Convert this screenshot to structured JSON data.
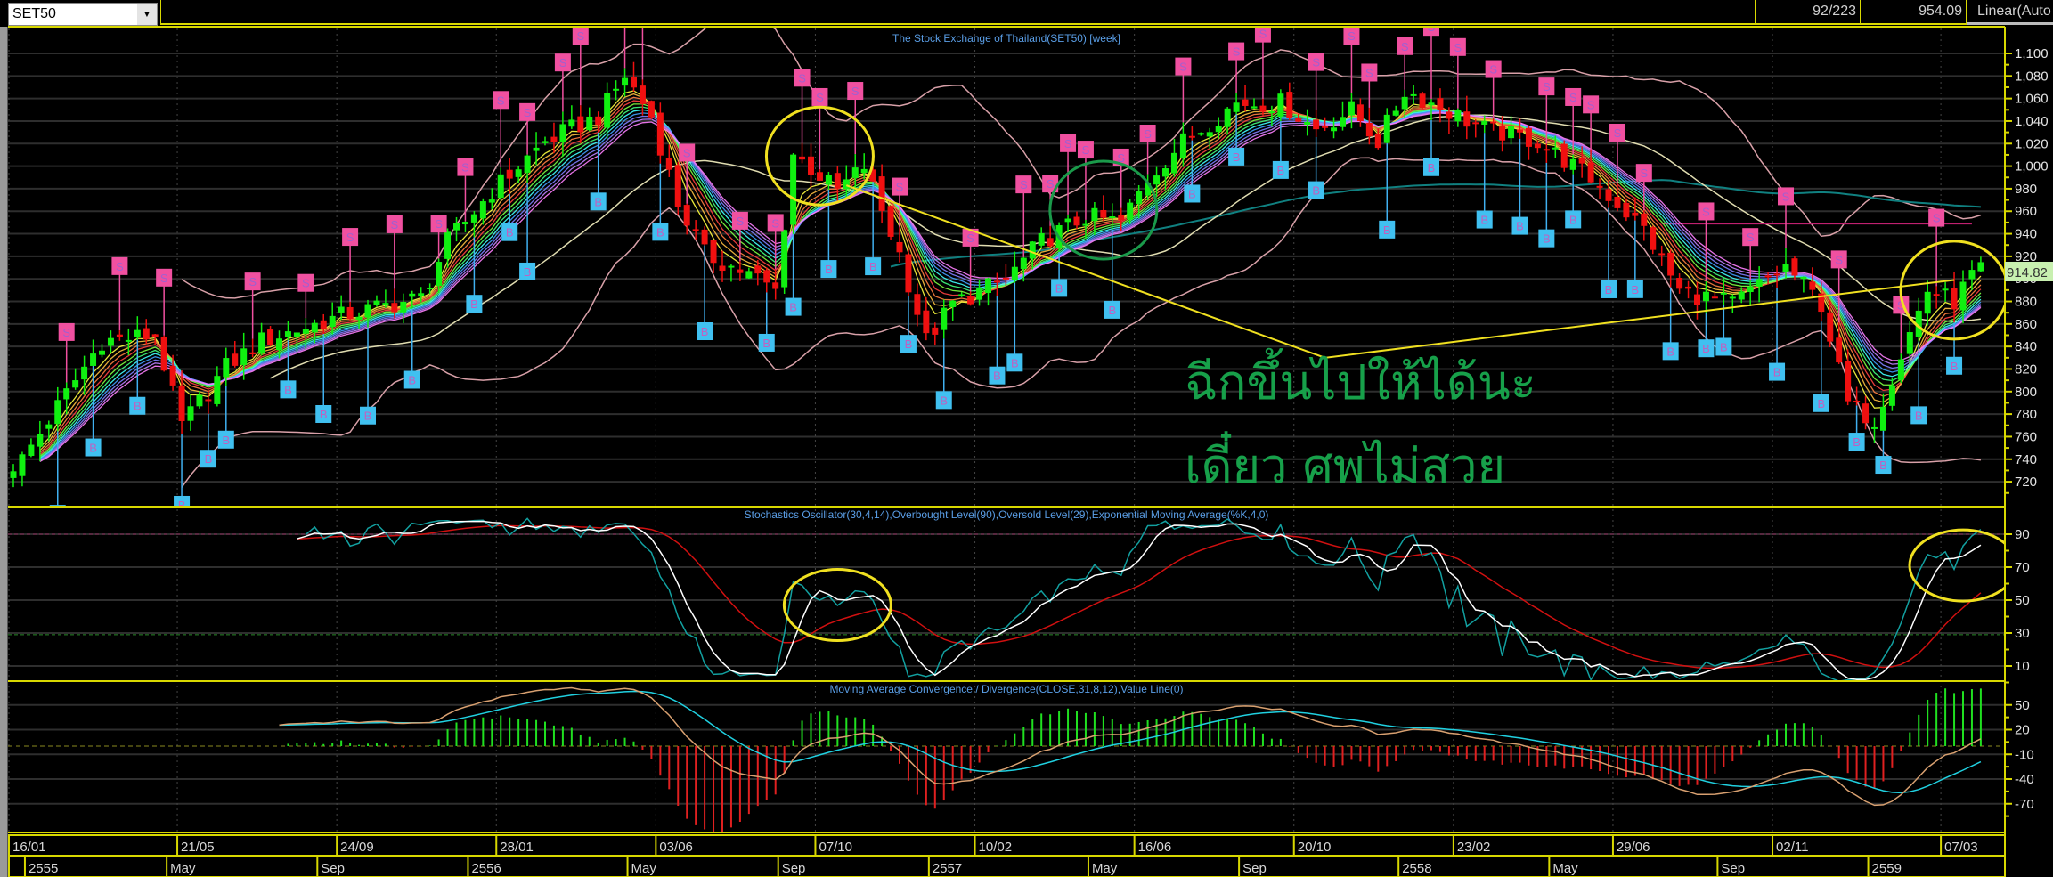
{
  "toolbar": {
    "symbol": "SET50",
    "dropdown_icon": "chevron-down-icon",
    "bar_position": "92/223",
    "cursor_value": "954.09",
    "scale_mode": "Linear(Auto"
  },
  "panels": {
    "main_title": "The Stock Exchange of Thailand(SET50) [week]",
    "stoch_title": "Stochastics Oscillator(30,4,14),Overbought Level(90),Oversold Level(29),Exponential Moving Average(%K,4,0)",
    "macd_title": "Moving Average Convergence / Divergence(CLOSE,31,8,12),Value Line(0)"
  },
  "annotations": {
    "thai_line1": "ฉีกขึ้นไปให้ได้นะ",
    "thai_line2": "เดี๋ยว ศพไม่สวย",
    "last_price_label": "914.82"
  },
  "chart_data": {
    "type": "candlestick",
    "title": "The Stock Exchange of Thailand(SET50) [week]",
    "weeks": 223,
    "last_close": 914.82,
    "close_anchors": [
      [
        0,
        735
      ],
      [
        1,
        740
      ],
      [
        10,
        845
      ],
      [
        16,
        850
      ],
      [
        19,
        770
      ],
      [
        24,
        822
      ],
      [
        28,
        845
      ],
      [
        37,
        867
      ],
      [
        43,
        878
      ],
      [
        46,
        883
      ],
      [
        49,
        933
      ],
      [
        54,
        978
      ],
      [
        60,
        1022
      ],
      [
        66,
        1044
      ],
      [
        69,
        1080
      ],
      [
        72,
        1044
      ],
      [
        75,
        967
      ],
      [
        78,
        922
      ],
      [
        84,
        900
      ],
      [
        86,
        889
      ],
      [
        88,
        1011
      ],
      [
        93,
        978
      ],
      [
        96,
        1000
      ],
      [
        100,
        922
      ],
      [
        103,
        845
      ],
      [
        106,
        878
      ],
      [
        112,
        900
      ],
      [
        116,
        933
      ],
      [
        121,
        955
      ],
      [
        125,
        950
      ],
      [
        128,
        989
      ],
      [
        132,
        1022
      ],
      [
        138,
        1056
      ],
      [
        143,
        1056
      ],
      [
        147,
        1033
      ],
      [
        151,
        1050
      ],
      [
        154,
        1022
      ],
      [
        157,
        1067
      ],
      [
        160,
        1056
      ],
      [
        166,
        1033
      ],
      [
        172,
        1022
      ],
      [
        178,
        989
      ],
      [
        184,
        944
      ],
      [
        188,
        889
      ],
      [
        194,
        878
      ],
      [
        200,
        911
      ],
      [
        204,
        878
      ],
      [
        207,
        789
      ],
      [
        210,
        775
      ],
      [
        213,
        833
      ],
      [
        216,
        890
      ],
      [
        219,
        880
      ],
      [
        222,
        914.82
      ]
    ],
    "sell_signals": [
      6,
      12,
      17,
      27,
      33,
      38,
      43,
      48,
      51,
      55,
      58,
      62,
      64,
      69,
      71,
      76,
      82,
      86,
      89,
      91,
      95,
      100,
      108,
      114,
      117,
      119,
      121,
      125,
      128,
      132,
      138,
      141,
      147,
      151,
      153,
      157,
      160,
      163,
      167,
      173,
      176,
      178,
      181,
      184,
      191,
      196,
      200,
      206,
      213,
      217
    ],
    "buy_signals": [
      5,
      9,
      14,
      19,
      22,
      24,
      31,
      35,
      40,
      45,
      52,
      56,
      58,
      66,
      73,
      78,
      85,
      88,
      92,
      97,
      101,
      105,
      111,
      113,
      118,
      124,
      133,
      138,
      143,
      147,
      155,
      160,
      166,
      170,
      173,
      176,
      180,
      183,
      187,
      191,
      193,
      199,
      204,
      208,
      211,
      215,
      219
    ],
    "signal_labels": {
      "sell": "S",
      "buy": "B"
    },
    "ribbon_periods": [
      4,
      5,
      6,
      7,
      8,
      9,
      10,
      11,
      12,
      13,
      14
    ],
    "ribbon_colors": [
      "#ffff40",
      "#ffc040",
      "#ff8040",
      "#ff4040",
      "#80ff40",
      "#40ff80",
      "#40ffff",
      "#40a0ff",
      "#8080ff",
      "#c080ff",
      "#ff80ff"
    ],
    "bollinger": {
      "period": 20,
      "k": 2,
      "color": "#d8a0a8"
    },
    "long_ma": {
      "period": 100,
      "color": "#108080"
    },
    "mid_ma": {
      "period": 30,
      "color": "#e0dcb0"
    },
    "resistance_level": 949,
    "trendline_points": [
      [
        94,
        983
      ],
      [
        148,
        830
      ],
      [
        219,
        899
      ]
    ],
    "main_axis": {
      "ticks": [
        720,
        740,
        760,
        780,
        800,
        820,
        840,
        860,
        880,
        900,
        920,
        940,
        960,
        980,
        1000,
        1020,
        1040,
        1060,
        1080,
        1100
      ],
      "labels": [
        "720",
        "740",
        "760",
        "780",
        "800",
        "820",
        "840",
        "860",
        "880",
        "900",
        "920",
        "940",
        "960",
        "980",
        "1,000",
        "1,020",
        "1,040",
        "1,060",
        "1,080",
        "1,100"
      ]
    },
    "stoch": {
      "k_period": 30,
      "smooth": 4,
      "ema": 14,
      "overbought": 90,
      "oversold": 29,
      "ticks": [
        10,
        30,
        50,
        70,
        90
      ],
      "labels": [
        "10",
        "30",
        "50",
        "70",
        "90"
      ],
      "colors": {
        "k": "#ffffff",
        "raw": "#12a0a0",
        "signal": "#d01010"
      }
    },
    "macd": {
      "fast": 8,
      "slow": 31,
      "signal": 12,
      "ticks": [
        50,
        20,
        -10,
        -40,
        -70
      ],
      "labels": [
        "50",
        "20",
        "-10",
        "-40",
        "-70"
      ],
      "colors": {
        "macd": "#d8a070",
        "signal": "#20d0e0",
        "up": "#20e020",
        "down": "#e02020"
      }
    },
    "date_ticks": [
      {
        "w": 0,
        "label": "16/01"
      },
      {
        "w": 19,
        "label": "21/05"
      },
      {
        "w": 37,
        "label": "24/09"
      },
      {
        "w": 55,
        "label": "28/01"
      },
      {
        "w": 73,
        "label": "03/06"
      },
      {
        "w": 91,
        "label": "07/10"
      },
      {
        "w": 109,
        "label": "10/02"
      },
      {
        "w": 127,
        "label": "16/06"
      },
      {
        "w": 145,
        "label": "20/10"
      },
      {
        "w": 163,
        "label": "23/02"
      },
      {
        "w": 181,
        "label": "29/06"
      },
      {
        "w": 199,
        "label": "02/11"
      },
      {
        "w": 218,
        "label": "07/03"
      }
    ],
    "period_ticks": [
      {
        "w": 1,
        "label": "2555"
      },
      {
        "w": 17,
        "label": "May"
      },
      {
        "w": 34,
        "label": "Sep"
      },
      {
        "w": 51,
        "label": "2556"
      },
      {
        "w": 69,
        "label": "May"
      },
      {
        "w": 86,
        "label": "Sep"
      },
      {
        "w": 103,
        "label": "2557"
      },
      {
        "w": 121,
        "label": "May"
      },
      {
        "w": 138,
        "label": "Sep"
      },
      {
        "w": 156,
        "label": "2558"
      },
      {
        "w": 173,
        "label": "May"
      },
      {
        "w": 192,
        "label": "Sep"
      },
      {
        "w": 209,
        "label": "2559"
      }
    ],
    "highlight_circles": [
      {
        "panel": "main",
        "w": 91,
        "value": 1009,
        "color": "#f0e020"
      },
      {
        "panel": "main",
        "w": 123,
        "value": 961,
        "color": "#1a9a4a"
      },
      {
        "panel": "main",
        "w": 219,
        "value": 890,
        "color": "#f0e020"
      },
      {
        "panel": "stoch",
        "w": 93,
        "value": 47,
        "color": "#f0e020"
      },
      {
        "panel": "stoch",
        "w": 220,
        "value": 71,
        "color": "#f0e020"
      }
    ]
  }
}
